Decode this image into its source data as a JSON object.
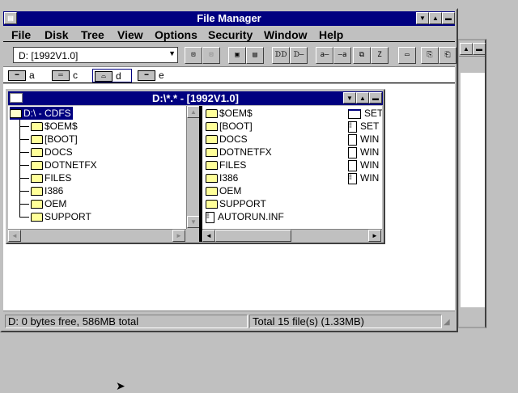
{
  "window": {
    "title": "File Manager"
  },
  "menu": [
    "File",
    "Disk",
    "Tree",
    "View",
    "Options",
    "Security",
    "Window",
    "Help"
  ],
  "toolbar": {
    "drive_combo": "D: [1992V1.0]",
    "buttons": [
      "connect-drive",
      "disconnect-drive",
      "share",
      "stop-sharing",
      "large-icons",
      "details",
      "sort-by-name",
      "sort-by-type",
      "copy",
      "move-window",
      "new-window",
      "copy-file",
      "paste"
    ]
  },
  "drives": [
    {
      "letter": "a"
    },
    {
      "letter": "c"
    },
    {
      "letter": "d"
    },
    {
      "letter": "e"
    }
  ],
  "child": {
    "title": "D:\\*.* - [1992V1.0]",
    "tree_root": "D:\\ - CDFS",
    "tree": [
      "$OEM$",
      "[BOOT]",
      "DOCS",
      "DOTNETFX",
      "FILES",
      "I386",
      "OEM",
      "SUPPORT"
    ],
    "files": [
      {
        "name": "$OEM$",
        "type": "folder"
      },
      {
        "name": "[BOOT]",
        "type": "folder"
      },
      {
        "name": "DOCS",
        "type": "folder"
      },
      {
        "name": "DOTNETFX",
        "type": "folder"
      },
      {
        "name": "FILES",
        "type": "folder"
      },
      {
        "name": "I386",
        "type": "folder"
      },
      {
        "name": "OEM",
        "type": "folder"
      },
      {
        "name": "SUPPORT",
        "type": "folder"
      },
      {
        "name": "AUTORUN.INF",
        "type": "doc"
      }
    ],
    "files_col2": [
      {
        "name": "SET",
        "type": "app"
      },
      {
        "name": "SET",
        "type": "doc"
      },
      {
        "name": "WIN",
        "type": "file"
      },
      {
        "name": "WIN",
        "type": "file"
      },
      {
        "name": "WIN",
        "type": "file"
      },
      {
        "name": "WIN",
        "type": "doc"
      }
    ]
  },
  "status": {
    "left": "D: 0 bytes free,  586MB total",
    "right": "Total 15 file(s) (1.33MB)"
  }
}
